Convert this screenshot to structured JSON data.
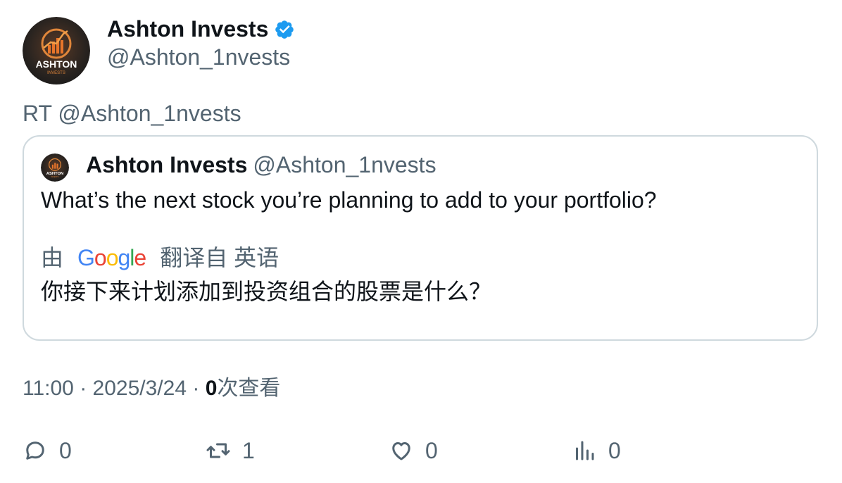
{
  "author": {
    "display_name": "Ashton Invests",
    "handle": "@Ashton_1nvests",
    "verified_icon": "verified-badge-icon",
    "avatar_text_main": "ASHTON",
    "avatar_text_sub": "INVESTS"
  },
  "retweet_line": "RT @Ashton_1nvests",
  "quote": {
    "display_name": "Ashton Invests",
    "handle": "@Ashton_1nvests",
    "text": "What’s the next stock you’re planning to add to your portfolio?",
    "translate_prefix": "由",
    "translate_provider": "Google",
    "translate_suffix": "翻译自 英语",
    "translation": "你接下来计划添加到投资组合的股票是什么？"
  },
  "meta": {
    "time": "11:00",
    "separator": "·",
    "date": "2025/3/24",
    "views_count": "0",
    "views_label": "次查看"
  },
  "actions": {
    "reply": {
      "icon": "reply-icon",
      "count": "0"
    },
    "retweet": {
      "icon": "retweet-icon",
      "count": "1"
    },
    "like": {
      "icon": "heart-icon",
      "count": "0"
    },
    "views": {
      "icon": "analytics-icon",
      "count": "0"
    }
  },
  "colors": {
    "text_primary": "#0f1419",
    "text_secondary": "#536471",
    "border": "#cfd9de",
    "verified": "#1d9bf0"
  }
}
